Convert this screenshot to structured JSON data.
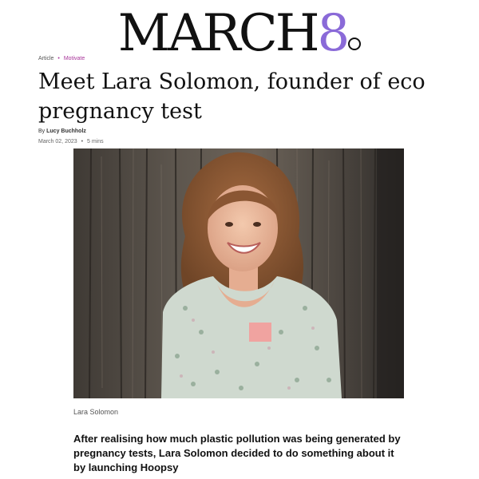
{
  "masthead": {
    "brand_word": "MARCH",
    "brand_number": "8",
    "accent_color": "#8a6ad8"
  },
  "breadcrumb": {
    "section": "Article",
    "separator": "•",
    "category": "Motivate"
  },
  "article": {
    "headline": "Meet Lara Solomon, founder of eco pregnancy test",
    "byline_prefix": "By",
    "author": "Lucy Buchholz",
    "date": "March 02, 2023",
    "meta_separator": "•",
    "read_time": "5 mins",
    "image_caption": "Lara Solomon",
    "lede": "After realising how much plastic pollution was being generated by pregnancy tests, Lara Solomon decided to do something about it by launching Hoopsy"
  }
}
